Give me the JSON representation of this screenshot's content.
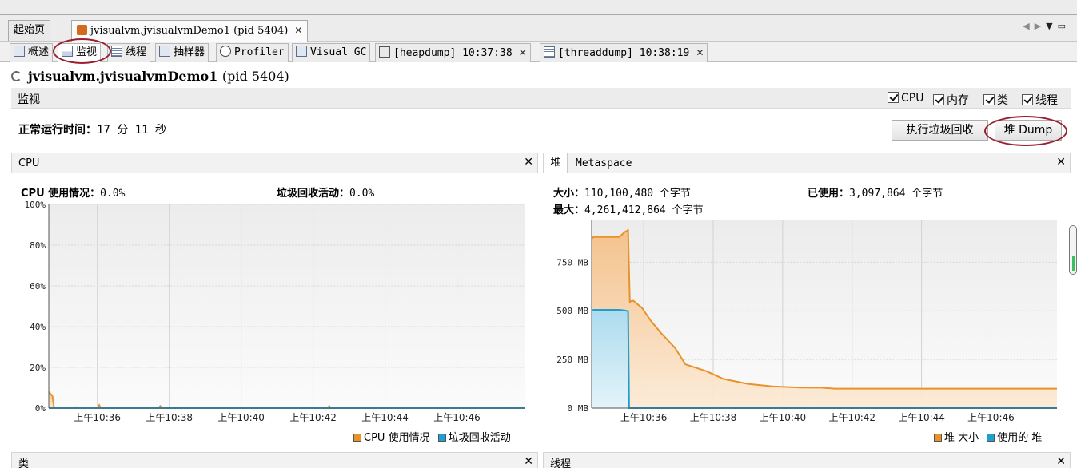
{
  "doc_tabs": [
    {
      "label": "起始页"
    },
    {
      "label": "jvisualvm.jvisualvmDemo1 (pid 5404)"
    }
  ],
  "sub_tabs": [
    {
      "label": "概述",
      "icon": "overview-icon"
    },
    {
      "label": "监视",
      "icon": "monitor-icon"
    },
    {
      "label": "线程",
      "icon": "threads-icon"
    },
    {
      "label": "抽样器",
      "icon": "sampler-icon"
    },
    {
      "label": "Profiler",
      "icon": "profiler-icon"
    },
    {
      "label": "Visual GC",
      "icon": "visualgc-icon"
    },
    {
      "label": "[heapdump] 10:37:38",
      "icon": "heapdump-icon"
    },
    {
      "label": "[threaddump] 10:38:19",
      "icon": "threaddump-icon"
    }
  ],
  "app_title": {
    "name": "jvisualvm.jvisualvmDemo1",
    "pid": "(pid 5404)"
  },
  "section": {
    "label": "监视",
    "checkboxes": [
      "CPU",
      "内存",
      "类",
      "线程"
    ]
  },
  "uptime": {
    "label": "正常运行时间：",
    "value": "17 分 11 秒"
  },
  "buttons": {
    "gc": "执行垃圾回收",
    "heap_dump": "堆 Dump"
  },
  "cpu_panel": {
    "title": "CPU",
    "usage_label": "CPU 使用情况：",
    "usage_value": "0.0%",
    "gc_label": "垃圾回收活动：",
    "gc_value": "0.0%",
    "legend": [
      "CPU 使用情况",
      "垃圾回收活动"
    ]
  },
  "heap_panel": {
    "tabs": [
      "堆",
      "Metaspace"
    ],
    "size_label": "大小：",
    "size_value": "110,100,480 个字节",
    "used_label": "已使用：",
    "used_value": "3,097,864 个字节",
    "max_label": "最大：",
    "max_value": "4,261,412,864 个字节",
    "legend": [
      "堆 大小",
      "使用的 堆"
    ]
  },
  "bottom_panels": {
    "classes": "类",
    "threads": "线程"
  },
  "colors": {
    "accent_orange": "#e8922a",
    "accent_blue": "#1e9fd0",
    "annotation": "#9a1f2e"
  },
  "chart_data": [
    {
      "type": "area",
      "name": "CPU",
      "y_tick_labels": [
        "0%",
        "20%",
        "40%",
        "60%",
        "80%",
        "100%"
      ],
      "ylim": [
        0,
        100
      ],
      "x_tick_labels": [
        "上午10:36",
        "上午10:38",
        "上午10:40",
        "上午10:42",
        "上午10:44",
        "上午10:46"
      ],
      "xlim_minutes": [
        34.65,
        47.9
      ],
      "x_ticks_minutes": [
        36,
        38,
        40,
        42,
        44,
        46
      ],
      "series": [
        {
          "name": "CPU 使用情况",
          "x": [
            34.65,
            34.75,
            34.8,
            35.3,
            35.35,
            36.0,
            36.05,
            36.1,
            37.7,
            37.75,
            37.8,
            42.4,
            42.45,
            42.5,
            47.9
          ],
          "values": [
            8,
            6,
            0,
            0,
            0.5,
            0,
            1.5,
            0,
            0,
            1,
            0,
            0,
            1,
            0,
            0
          ]
        },
        {
          "name": "垃圾回收活动",
          "x": [
            34.65,
            47.9
          ],
          "values": [
            0,
            0
          ]
        }
      ],
      "grid": true
    },
    {
      "type": "area",
      "name": "堆",
      "y_tick_labels": [
        "0 MB",
        "250 MB",
        "500 MB",
        "750 MB"
      ],
      "ylim": [
        0,
        965
      ],
      "x_tick_labels": [
        "上午10:36",
        "上午10:38",
        "上午10:40",
        "上午10:42",
        "上午10:44",
        "上午10:46"
      ],
      "xlim_minutes": [
        34.5,
        47.9
      ],
      "x_ticks_minutes": [
        36,
        38,
        40,
        42,
        44,
        46
      ],
      "series": [
        {
          "name": "堆 大小",
          "x": [
            34.5,
            34.55,
            35.3,
            35.45,
            35.55,
            35.6,
            35.62,
            35.7,
            35.95,
            36.2,
            36.5,
            36.9,
            37.2,
            37.8,
            38.3,
            39.0,
            39.7,
            40.5,
            41.1,
            41.5,
            47.9
          ],
          "values": [
            870,
            880,
            880,
            905,
            915,
            540,
            550,
            552,
            515,
            450,
            385,
            310,
            225,
            190,
            150,
            125,
            112,
            106,
            105,
            100,
            100
          ]
        },
        {
          "name": "使用的 堆",
          "x": [
            34.5,
            34.55,
            35.3,
            35.45,
            35.55,
            35.58,
            47.9
          ],
          "values": [
            500,
            505,
            505,
            502,
            498,
            0,
            0
          ]
        }
      ],
      "grid": true
    }
  ]
}
